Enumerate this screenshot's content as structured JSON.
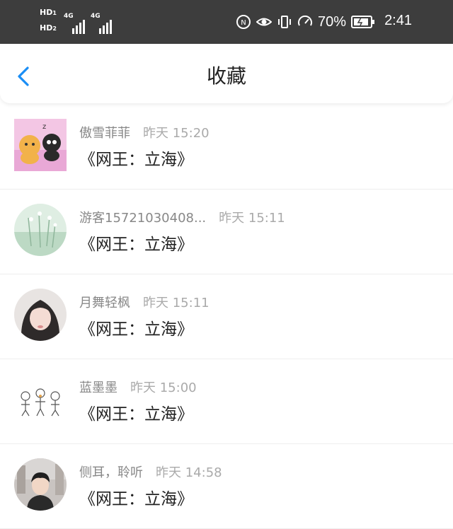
{
  "status_bar": {
    "hd1": "HD",
    "hd1_sub": "1",
    "hd2": "HD",
    "hd2_sub": "2",
    "net1": "4G",
    "net2": "4G",
    "battery_percent": "70%",
    "time": "2:41",
    "icons": [
      "nfc-icon",
      "eye-icon",
      "vibrate-icon",
      "speed-icon",
      "battery-icon"
    ]
  },
  "header": {
    "title": "收藏",
    "back_icon": "chevron-left-icon"
  },
  "favorites": [
    {
      "user": "傲雪菲菲",
      "time": "昨天 15:20",
      "content": "《网王：立海》"
    },
    {
      "user": "游客15721030408...",
      "time": "昨天 15:11",
      "content": "《网王：立海》"
    },
    {
      "user": "月舞轻枫",
      "time": "昨天 15:11",
      "content": "《网王：立海》"
    },
    {
      "user": "蓝墨墨",
      "time": "昨天 15:00",
      "content": "《网王：立海》"
    },
    {
      "user": "侧耳，聆听",
      "time": "昨天 14:58",
      "content": "《网王：立海》"
    }
  ],
  "colors": {
    "status_bar_bg": "#3d3d3d",
    "accent": "#1a8ef5",
    "username": "#888888",
    "timestamp": "#aaaaaa",
    "content_text": "#222222"
  }
}
